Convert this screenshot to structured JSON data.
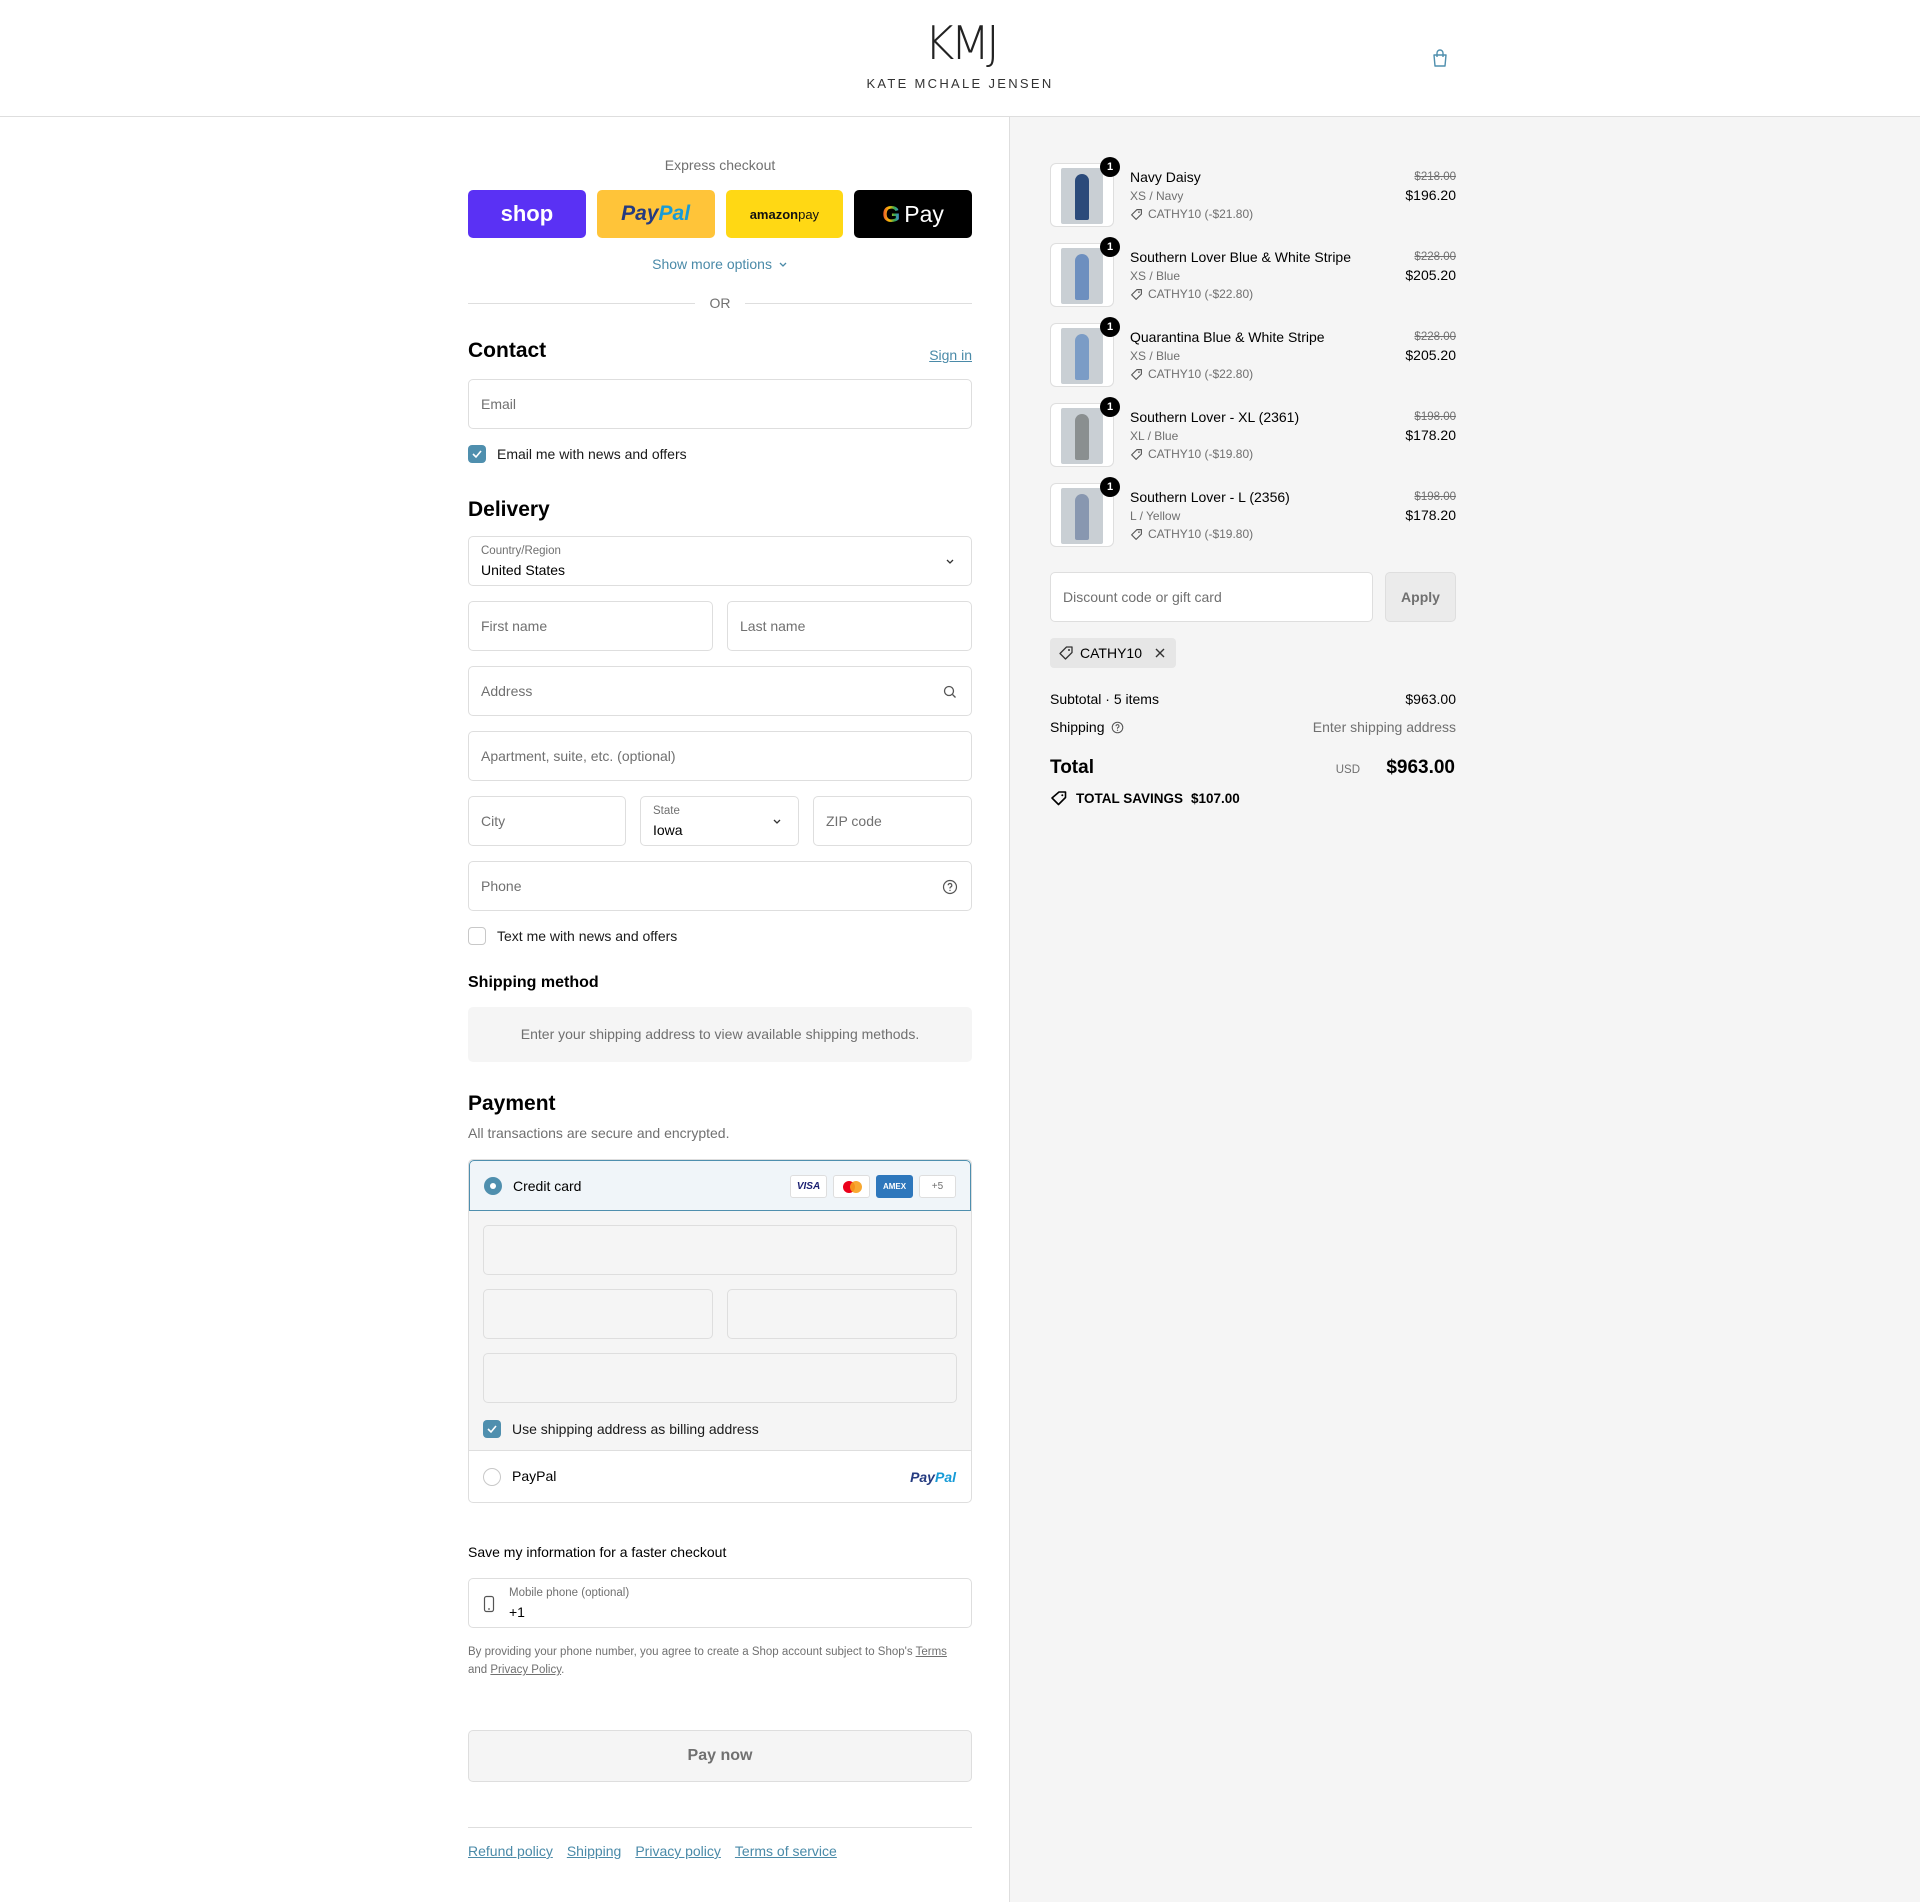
{
  "header": {
    "logo_mark": "KMJ",
    "logo_text": "KATE MCHALE JENSEN"
  },
  "express": {
    "title": "Express checkout",
    "shop_label": "shop",
    "paypal_a": "Pay",
    "paypal_b": "Pal",
    "amazon_a": "amazon",
    "amazon_b": " pay",
    "gpay_g": "G",
    "gpay_label": "Pay",
    "more_options": "Show more options",
    "or": "OR"
  },
  "contact": {
    "title": "Contact",
    "sign_in": "Sign in",
    "email_placeholder": "Email",
    "news_label": "Email me with news and offers"
  },
  "delivery": {
    "title": "Delivery",
    "country_label": "Country/Region",
    "country_value": "United States",
    "first_name": "First name",
    "last_name": "Last name",
    "address": "Address",
    "apartment": "Apartment, suite, etc. (optional)",
    "city": "City",
    "state_label": "State",
    "state_value": "Iowa",
    "zip": "ZIP code",
    "phone": "Phone",
    "text_label": "Text me with news and offers"
  },
  "shipping": {
    "title": "Shipping method",
    "note": "Enter your shipping address to view available shipping methods."
  },
  "payment": {
    "title": "Payment",
    "desc": "All transactions are secure and encrypted.",
    "credit_card": "Credit card",
    "cards": {
      "visa": "VISA",
      "amex": "AMEX",
      "more": "+5"
    },
    "billing_label": "Use shipping address as billing address",
    "paypal": "PayPal",
    "paypal_logo_a": "Pay",
    "paypal_logo_b": "Pal"
  },
  "save": {
    "title": "Save my information for a faster checkout",
    "mobile_label": "Mobile phone (optional)",
    "mobile_value": "+1",
    "legal_a": "By providing your phone number, you agree to create a Shop account subject to Shop's ",
    "terms": "Terms",
    "legal_b": " and ",
    "privacy": "Privacy Policy",
    "legal_c": "."
  },
  "pay_now": "Pay now",
  "footer": {
    "refund": "Refund policy",
    "shipping": "Shipping",
    "privacy": "Privacy policy",
    "terms": "Terms of service"
  },
  "items": [
    {
      "qty": "1",
      "name": "Navy Daisy",
      "variant": "XS / Navy",
      "discount": "CATHY10 (-$21.80)",
      "original": "$218.00",
      "price": "$196.20",
      "color": "#2b4a7a"
    },
    {
      "qty": "1",
      "name": "Southern Lover Blue & White Stripe",
      "variant": "XS / Blue",
      "discount": "CATHY10 (-$22.80)",
      "original": "$228.00",
      "price": "$205.20",
      "color": "#6d8fbf"
    },
    {
      "qty": "1",
      "name": "Quarantina Blue & White Stripe",
      "variant": "XS / Blue",
      "discount": "CATHY10 (-$22.80)",
      "original": "$228.00",
      "price": "$205.20",
      "color": "#7b9cc6"
    },
    {
      "qty": "1",
      "name": "Southern Lover - XL (2361)",
      "variant": "XL / Blue",
      "discount": "CATHY10 (-$19.80)",
      "original": "$198.00",
      "price": "$178.20",
      "color": "#8a8f90"
    },
    {
      "qty": "1",
      "name": "Southern Lover - L (2356)",
      "variant": "L / Yellow",
      "discount": "CATHY10 (-$19.80)",
      "original": "$198.00",
      "price": "$178.20",
      "color": "#8897b0"
    }
  ],
  "summary": {
    "discount_placeholder": "Discount code or gift card",
    "apply": "Apply",
    "code": "CATHY10",
    "subtotal_label": "Subtotal · 5 items",
    "subtotal_value": "$963.00",
    "shipping_label": "Shipping",
    "shipping_value": "Enter shipping address",
    "total_label": "Total",
    "currency": "USD",
    "total_value": "$963.00",
    "savings_label": "TOTAL SAVINGS",
    "savings_value": "$107.00"
  }
}
